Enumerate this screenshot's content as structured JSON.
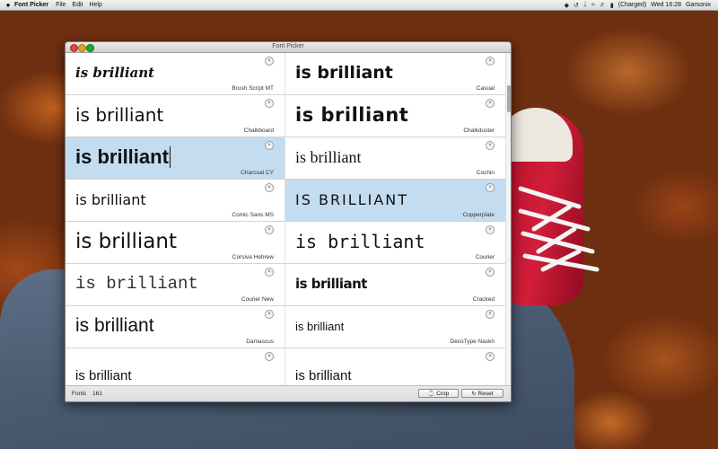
{
  "menubar": {
    "app_name": "Font Picker",
    "items": [
      "File",
      "Edit",
      "Help"
    ],
    "battery": "(Charged)",
    "datetime": "Wed 16:28",
    "user": "Garsonix"
  },
  "window": {
    "title": "Font Picker"
  },
  "sample_text": "is brilliant",
  "fonts": [
    {
      "name": "Brush Script MT",
      "sample": "is brilliant",
      "selected": false
    },
    {
      "name": "Casual",
      "sample": "is brilliant",
      "selected": false
    },
    {
      "name": "Chalkboard",
      "sample": "is brilliant",
      "selected": false
    },
    {
      "name": "Chalkduster",
      "sample": "is brilliant",
      "selected": false
    },
    {
      "name": "Charcoal CY",
      "sample": "is brilliant",
      "selected": true
    },
    {
      "name": "Cochin",
      "sample": "is brilliant",
      "selected": false
    },
    {
      "name": "Comic Sans MS",
      "sample": "is brilliant",
      "selected": false
    },
    {
      "name": "Copperplate",
      "sample": "IS BRILLIANT",
      "selected": true
    },
    {
      "name": "Corsiva Hebrew",
      "sample": "is brilliant",
      "selected": false
    },
    {
      "name": "Courier",
      "sample": "is brilliant",
      "selected": false
    },
    {
      "name": "Courier New",
      "sample": "is brilliant",
      "selected": false
    },
    {
      "name": "Cracked",
      "sample": "is brilliant",
      "selected": false
    },
    {
      "name": "Damascus",
      "sample": "is brilliant",
      "selected": false
    },
    {
      "name": "DecoType Naskh",
      "sample": "is brilliant",
      "selected": false
    },
    {
      "name": "",
      "sample": "is brilliant",
      "selected": false
    },
    {
      "name": "",
      "sample": "is brilliant",
      "selected": false
    }
  ],
  "footer": {
    "fonts_label": "Fonts",
    "fonts_count": "161",
    "crop_label": "Crop",
    "reset_label": "Reset"
  },
  "icons": {
    "apple": "apple-icon",
    "remove": "close-circle-icon",
    "crop": "crop-icon",
    "reset": "reset-icon"
  },
  "colors": {
    "selection": "#c3dcf0",
    "close": "#e0443e",
    "minimize": "#dea123",
    "zoom": "#1aab29"
  }
}
